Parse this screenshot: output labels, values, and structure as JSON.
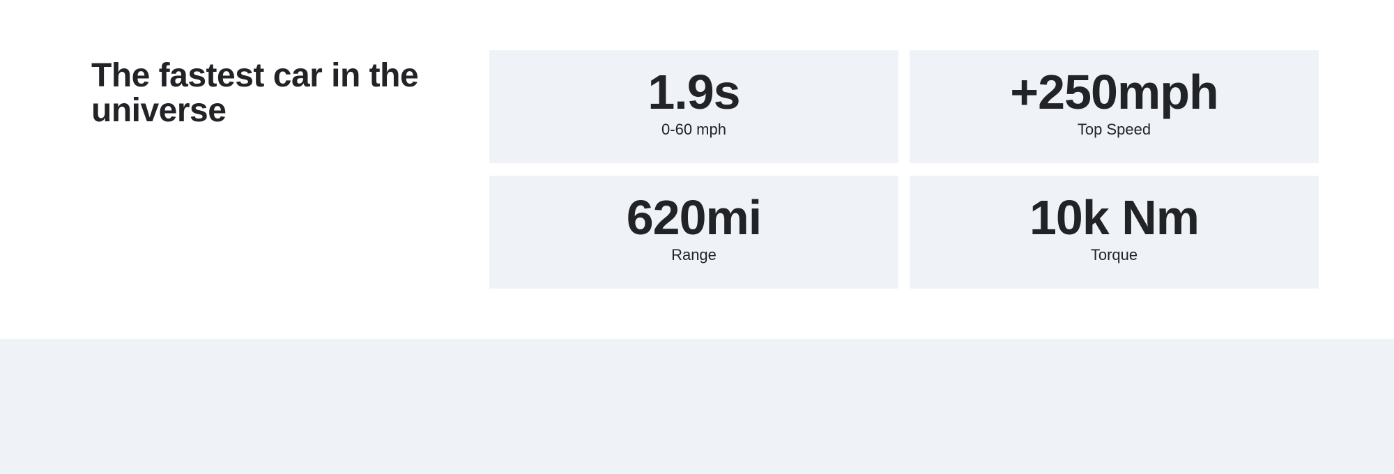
{
  "headline": "The fastest car in the universe",
  "stats": [
    {
      "value": "1.9s",
      "label": "0-60 mph"
    },
    {
      "value": "+250mph",
      "label": "Top Speed"
    },
    {
      "value": "620mi",
      "label": "Range"
    },
    {
      "value": "10k Nm",
      "label": "Torque"
    }
  ],
  "colors": {
    "text": "#222326",
    "card_background": "#eff3f7",
    "page_background": "#ffffff"
  }
}
